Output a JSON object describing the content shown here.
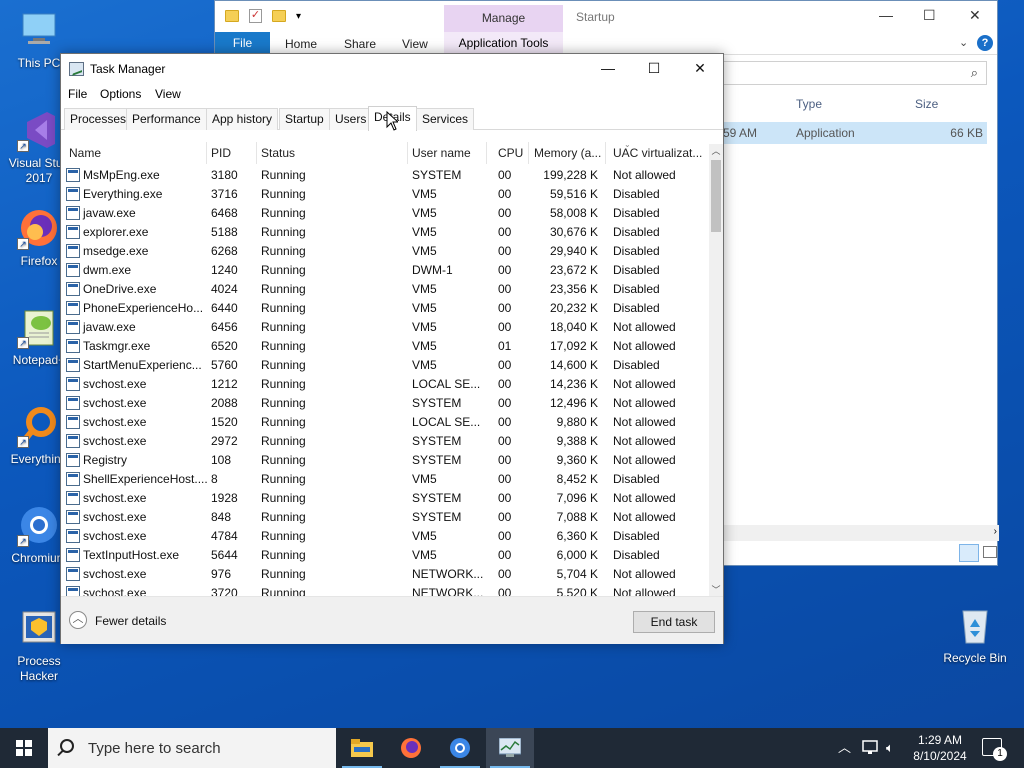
{
  "desktop": {
    "icons": [
      {
        "label": "This PC",
        "icon": "computer-icon"
      },
      {
        "label": "Visual Studio 2017",
        "label_line1": "Visual Stud",
        "label_line2": "2017",
        "icon": "visual-studio-icon"
      },
      {
        "label": "Firefox",
        "icon": "firefox-icon"
      },
      {
        "label": "Notepad+",
        "icon": "notepad-plus-icon"
      },
      {
        "label": "Everything",
        "icon": "everything-search-icon"
      },
      {
        "label": "Chromium",
        "icon": "chromium-icon"
      },
      {
        "label": "Process Hacker",
        "label_line1": "Process",
        "label_line2": "Hacker",
        "icon": "process-hacker-icon"
      },
      {
        "label": "Recycle Bin",
        "icon": "recycle-bin-icon"
      }
    ]
  },
  "explorer": {
    "ribbon": {
      "file": "File",
      "home": "Home",
      "share": "Share",
      "view": "View",
      "manage": "Manage",
      "app_tools": "Application Tools"
    },
    "title": "Startup",
    "columns": {
      "type": "Type",
      "size": "Size"
    },
    "row": {
      "time": "59 AM",
      "type": "Application",
      "size": "66 KB"
    }
  },
  "taskmanager": {
    "title": "Task Manager",
    "menu": [
      "File",
      "Options",
      "View"
    ],
    "tabs": [
      "Processes",
      "Performance",
      "App history",
      "Startup",
      "Users",
      "Details",
      "Services"
    ],
    "active_tab": "Details",
    "columns": [
      "Name",
      "PID",
      "Status",
      "User name",
      "CPU",
      "Memory (a...",
      "UAC virtualizat..."
    ],
    "rows": [
      {
        "name": "MsMpEng.exe",
        "pid": "3180",
        "status": "Running",
        "user": "SYSTEM",
        "cpu": "00",
        "mem": "199,228 K",
        "uac": "Not allowed",
        "icon": "app-window-icon"
      },
      {
        "name": "Everything.exe",
        "pid": "3716",
        "status": "Running",
        "user": "VM5",
        "cpu": "00",
        "mem": "59,516 K",
        "uac": "Disabled",
        "icon": "everything-search-icon"
      },
      {
        "name": "javaw.exe",
        "pid": "6468",
        "status": "Running",
        "user": "VM5",
        "cpu": "00",
        "mem": "58,008 K",
        "uac": "Disabled",
        "icon": "java-icon"
      },
      {
        "name": "explorer.exe",
        "pid": "5188",
        "status": "Running",
        "user": "VM5",
        "cpu": "00",
        "mem": "30,676 K",
        "uac": "Disabled",
        "icon": "folder-icon"
      },
      {
        "name": "msedge.exe",
        "pid": "6268",
        "status": "Running",
        "user": "VM5",
        "cpu": "00",
        "mem": "29,940 K",
        "uac": "Disabled",
        "icon": "edge-icon"
      },
      {
        "name": "dwm.exe",
        "pid": "1240",
        "status": "Running",
        "user": "DWM-1",
        "cpu": "00",
        "mem": "23,672 K",
        "uac": "Disabled",
        "icon": "app-window-icon"
      },
      {
        "name": "OneDrive.exe",
        "pid": "4024",
        "status": "Running",
        "user": "VM5",
        "cpu": "00",
        "mem": "23,356 K",
        "uac": "Disabled",
        "icon": "onedrive-icon"
      },
      {
        "name": "PhoneExperienceHo...",
        "pid": "6440",
        "status": "Running",
        "user": "VM5",
        "cpu": "00",
        "mem": "20,232 K",
        "uac": "Disabled",
        "icon": "app-window-icon"
      },
      {
        "name": "javaw.exe",
        "pid": "6456",
        "status": "Running",
        "user": "VM5",
        "cpu": "00",
        "mem": "18,040 K",
        "uac": "Not allowed",
        "icon": "java-icon"
      },
      {
        "name": "Taskmgr.exe",
        "pid": "6520",
        "status": "Running",
        "user": "VM5",
        "cpu": "01",
        "mem": "17,092 K",
        "uac": "Not allowed",
        "icon": "taskmgr-icon"
      },
      {
        "name": "StartMenuExperienc...",
        "pid": "5760",
        "status": "Running",
        "user": "VM5",
        "cpu": "00",
        "mem": "14,600 K",
        "uac": "Disabled",
        "icon": "app-window-icon"
      },
      {
        "name": "svchost.exe",
        "pid": "1212",
        "status": "Running",
        "user": "LOCAL SE...",
        "cpu": "00",
        "mem": "14,236 K",
        "uac": "Not allowed",
        "icon": "app-window-icon"
      },
      {
        "name": "svchost.exe",
        "pid": "2088",
        "status": "Running",
        "user": "SYSTEM",
        "cpu": "00",
        "mem": "12,496 K",
        "uac": "Not allowed",
        "icon": "app-window-icon"
      },
      {
        "name": "svchost.exe",
        "pid": "1520",
        "status": "Running",
        "user": "LOCAL SE...",
        "cpu": "00",
        "mem": "9,880 K",
        "uac": "Not allowed",
        "icon": "app-window-icon"
      },
      {
        "name": "svchost.exe",
        "pid": "2972",
        "status": "Running",
        "user": "SYSTEM",
        "cpu": "00",
        "mem": "9,388 K",
        "uac": "Not allowed",
        "icon": "app-window-icon"
      },
      {
        "name": "Registry",
        "pid": "108",
        "status": "Running",
        "user": "SYSTEM",
        "cpu": "00",
        "mem": "9,360 K",
        "uac": "Not allowed",
        "icon": "app-window-icon"
      },
      {
        "name": "ShellExperienceHost....",
        "pid": "8",
        "status": "Running",
        "user": "VM5",
        "cpu": "00",
        "mem": "8,452 K",
        "uac": "Disabled",
        "icon": "app-window-icon"
      },
      {
        "name": "svchost.exe",
        "pid": "1928",
        "status": "Running",
        "user": "SYSTEM",
        "cpu": "00",
        "mem": "7,096 K",
        "uac": "Not allowed",
        "icon": "app-window-icon"
      },
      {
        "name": "svchost.exe",
        "pid": "848",
        "status": "Running",
        "user": "SYSTEM",
        "cpu": "00",
        "mem": "7,088 K",
        "uac": "Not allowed",
        "icon": "app-window-icon"
      },
      {
        "name": "svchost.exe",
        "pid": "4784",
        "status": "Running",
        "user": "VM5",
        "cpu": "00",
        "mem": "6,360 K",
        "uac": "Disabled",
        "icon": "app-window-icon"
      },
      {
        "name": "TextInputHost.exe",
        "pid": "5644",
        "status": "Running",
        "user": "VM5",
        "cpu": "00",
        "mem": "6,000 K",
        "uac": "Disabled",
        "icon": "app-window-icon"
      },
      {
        "name": "svchost.exe",
        "pid": "976",
        "status": "Running",
        "user": "NETWORK...",
        "cpu": "00",
        "mem": "5,704 K",
        "uac": "Not allowed",
        "icon": "app-window-icon"
      },
      {
        "name": "svchost.exe",
        "pid": "3720",
        "status": "Running",
        "user": "NETWORK...",
        "cpu": "00",
        "mem": "5,520 K",
        "uac": "Not allowed",
        "icon": "app-window-icon"
      }
    ],
    "footer": {
      "fewer_details": "Fewer details",
      "end_task": "End task"
    }
  },
  "taskbar": {
    "search_placeholder": "Type here to search",
    "apps": [
      "file-explorer-icon",
      "firefox-icon",
      "chromium-icon",
      "taskmgr-icon"
    ],
    "time": "1:29 AM",
    "date": "8/10/2024",
    "notification_count": "1"
  }
}
